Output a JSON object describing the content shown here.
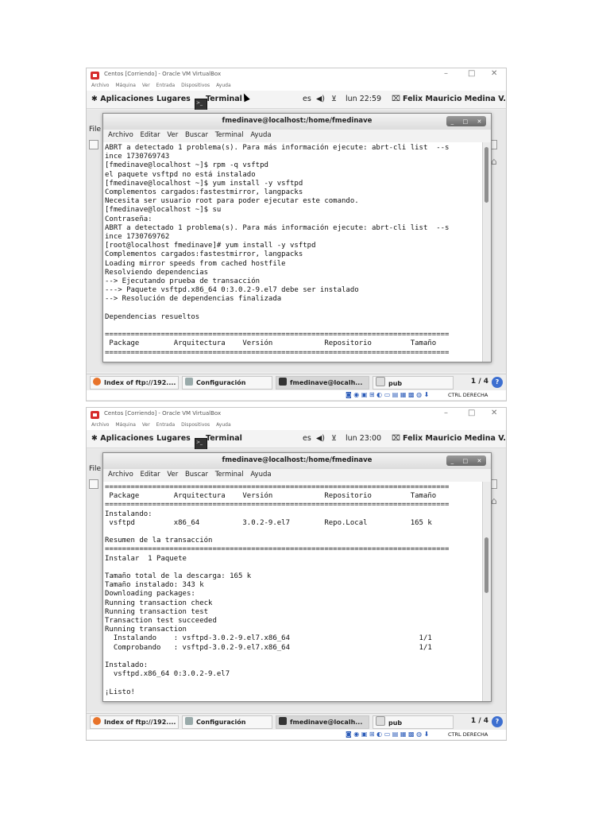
{
  "screens": [
    {
      "vb_title": "Centos [Corriendo] - Oracle VM VirtualBox",
      "vb_menu": [
        "Archivo",
        "Máquina",
        "Ver",
        "Entrada",
        "Dispositivos",
        "Ayuda"
      ],
      "panel": {
        "aplicaciones": "Aplicaciones",
        "lugares": "Lugares",
        "terminal": "Terminal",
        "lang": "es",
        "clock": "lun 22:59",
        "user": "Felix Mauricio Medina V..."
      },
      "bg_menu": "File",
      "terminal": {
        "title": "fmedinave@localhost:/home/fmedinave",
        "menu": [
          "Archivo",
          "Editar",
          "Ver",
          "Buscar",
          "Terminal",
          "Ayuda"
        ],
        "lines": [
          "ABRT a detectado 1 problema(s). Para más información ejecute: abrt-cli list  --s",
          "ince 1730769743",
          "[fmedinave@localhost ~]$ rpm -q vsftpd",
          "el paquete vsftpd no está instalado",
          "[fmedinave@localhost ~]$ yum install -y vsftpd",
          "Complementos cargados:fastestmirror, langpacks",
          "Necesita ser usuario root para poder ejecutar este comando.",
          "[fmedinave@localhost ~]$ su",
          "Contraseña:",
          "ABRT a detectado 1 problema(s). Para más información ejecute: abrt-cli list  --s",
          "ince 1730769762",
          "[root@localhost fmedinave]# yum install -y vsftpd",
          "Complementos cargados:fastestmirror, langpacks",
          "Loading mirror speeds from cached hostfile",
          "Resolviendo dependencias",
          "--> Ejecutando prueba de transacción",
          "---> Paquete vsftpd.x86_64 0:3.0.2-9.el7 debe ser instalado",
          "--> Resolución de dependencias finalizada",
          "",
          "Dependencias resueltos",
          "",
          "================================================================================",
          " Package        Arquitectura    Versión            Repositorio         Tamaño",
          "================================================================================"
        ]
      },
      "taskbar": {
        "items": [
          "Index of ftp://192....",
          "Configuración",
          "fmedinave@localh...",
          "pub"
        ],
        "pager": "1 / 4",
        "help": "?"
      },
      "status_key": "CTRL DERECHA"
    },
    {
      "vb_title": "Centos [Corriendo] - Oracle VM VirtualBox",
      "vb_menu": [
        "Archivo",
        "Máquina",
        "Ver",
        "Entrada",
        "Dispositivos",
        "Ayuda"
      ],
      "panel": {
        "aplicaciones": "Aplicaciones",
        "lugares": "Lugares",
        "terminal": "Terminal",
        "lang": "es",
        "clock": "lun 23:00",
        "user": "Felix Mauricio Medina V..."
      },
      "bg_menu": "File",
      "terminal": {
        "title": "fmedinave@localhost:/home/fmedinave",
        "menu": [
          "Archivo",
          "Editar",
          "Ver",
          "Buscar",
          "Terminal",
          "Ayuda"
        ],
        "lines": [
          "================================================================================",
          " Package        Arquitectura    Versión            Repositorio         Tamaño",
          "================================================================================",
          "Instalando:",
          " vsftpd         x86_64          3.0.2-9.el7        Repo.Local          165 k",
          "",
          "Resumen de la transacción",
          "================================================================================",
          "Instalar  1 Paquete",
          "",
          "Tamaño total de la descarga: 165 k",
          "Tamaño instalado: 343 k",
          "Downloading packages:",
          "Running transaction check",
          "Running transaction test",
          "Transaction test succeeded",
          "Running transaction",
          "  Instalando    : vsftpd-3.0.2-9.el7.x86_64                              1/1",
          "  Comprobando   : vsftpd-3.0.2-9.el7.x86_64                              1/1",
          "",
          "Instalado:",
          "  vsftpd.x86_64 0:3.0.2-9.el7",
          "",
          "¡Listo!"
        ]
      },
      "taskbar": {
        "items": [
          "Index of ftp://192....",
          "Configuración",
          "fmedinave@localh...",
          "pub"
        ],
        "pager": "1 / 4",
        "help": "?"
      },
      "status_key": "CTRL DERECHA"
    }
  ],
  "colors": {
    "vb_icon": "#d62b2b",
    "help_button": "#3d6fd0",
    "status_icons": "#2b5bb8"
  }
}
